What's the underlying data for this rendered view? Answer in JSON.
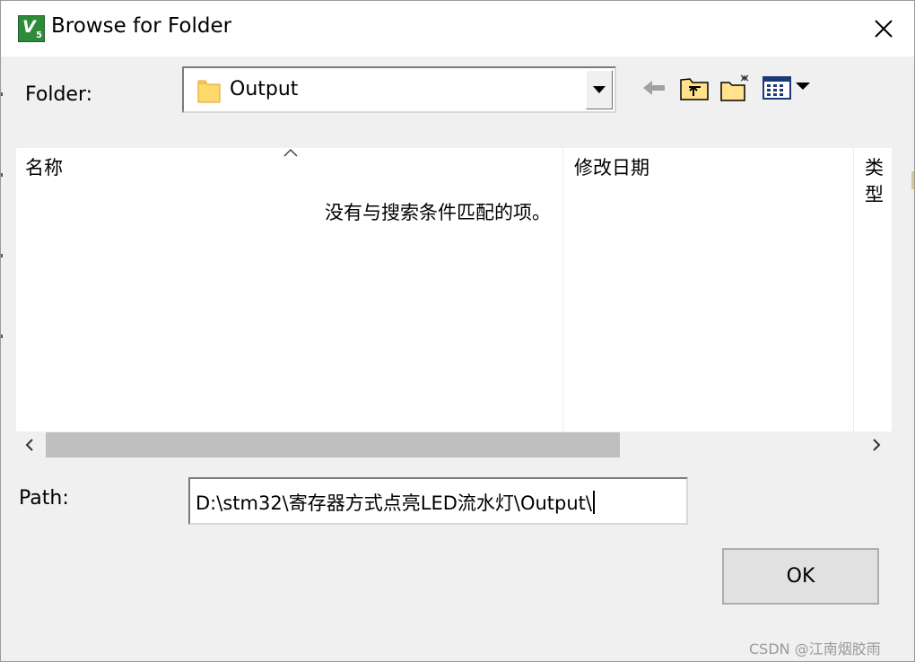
{
  "window": {
    "title": "Browse for Folder",
    "icon": "keil-uvision-icon"
  },
  "folder": {
    "label": "Folder:",
    "current": "Output"
  },
  "toolbar": [
    "back-arrow-icon",
    "up-one-level-icon",
    "new-folder-icon",
    "view-menu-icon"
  ],
  "list": {
    "columns": [
      "名称",
      "修改日期",
      "类型"
    ],
    "empty_message": "没有与搜索条件匹配的项。"
  },
  "path": {
    "label": "Path:",
    "value": "D:\\stm32\\寄存器方式点亮LED流水灯\\Output\\"
  },
  "buttons": {
    "ok": "OK"
  },
  "watermark": "CSDN @江南烟胶雨"
}
